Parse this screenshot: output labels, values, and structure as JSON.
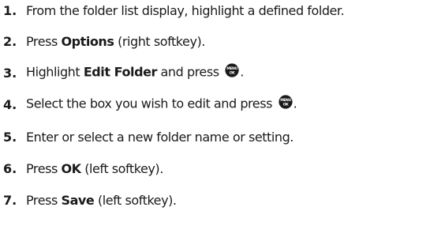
{
  "steps": [
    {
      "number": "1.",
      "parts": [
        {
          "text": "From the folder list display, highlight a defined folder."
        }
      ]
    },
    {
      "number": "2.",
      "parts": [
        {
          "text": "Press "
        },
        {
          "text": "Options",
          "bold": true
        },
        {
          "text": " (right softkey)."
        }
      ]
    },
    {
      "number": "3.",
      "parts": [
        {
          "text": "Highlight "
        },
        {
          "text": "Edit Folder",
          "bold": true
        },
        {
          "text": " and press "
        },
        {
          "icon": "menu-ok-key-icon"
        },
        {
          "text": "."
        }
      ]
    },
    {
      "number": "4.",
      "parts": [
        {
          "text": "Select the box you wish to edit and press "
        },
        {
          "icon": "menu-ok-key-icon"
        },
        {
          "text": "."
        }
      ]
    },
    {
      "number": "5.",
      "parts": [
        {
          "text": "Enter or select a new folder name or setting."
        }
      ]
    },
    {
      "number": "6.",
      "parts": [
        {
          "text": "Press "
        },
        {
          "text": "OK",
          "bold": true
        },
        {
          "text": " (left softkey)."
        }
      ]
    },
    {
      "number": "7.",
      "parts": [
        {
          "text": "Press "
        },
        {
          "text": "Save",
          "bold": true
        },
        {
          "text": " (left softkey)."
        }
      ]
    }
  ],
  "menu_key": {
    "label_top": "MENU",
    "label_bottom": "OK",
    "color": "#1a1a1a"
  }
}
